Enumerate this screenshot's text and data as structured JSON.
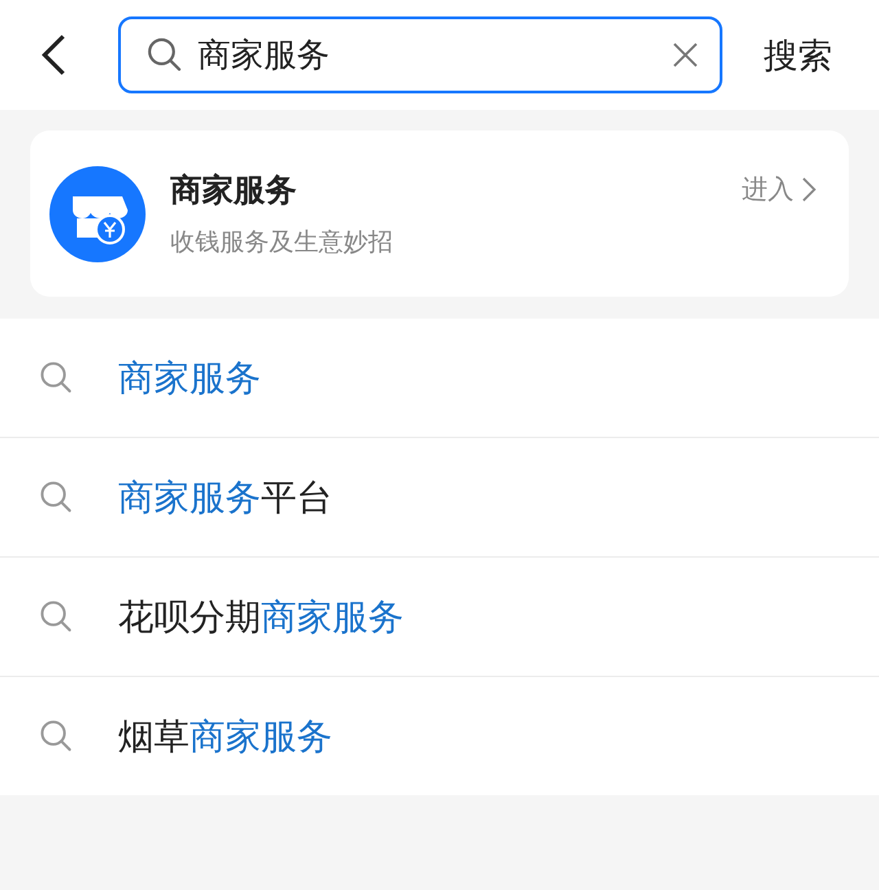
{
  "search_bar": {
    "value": "商家服务",
    "action": "搜索"
  },
  "result_card": {
    "title": "商家服务",
    "subtitle": "收钱服务及生意妙招",
    "action": "进入"
  },
  "suggestions": [
    {
      "segments": [
        {
          "text": "商家服务",
          "highlighted": true
        }
      ]
    },
    {
      "segments": [
        {
          "text": "商家服务",
          "highlighted": true
        },
        {
          "text": "平台",
          "highlighted": false
        }
      ]
    },
    {
      "segments": [
        {
          "text": "花呗分期",
          "highlighted": false
        },
        {
          "text": "商家服务",
          "highlighted": true
        }
      ]
    },
    {
      "segments": [
        {
          "text": "烟草",
          "highlighted": false
        },
        {
          "text": "商家服务",
          "highlighted": true
        }
      ]
    }
  ]
}
